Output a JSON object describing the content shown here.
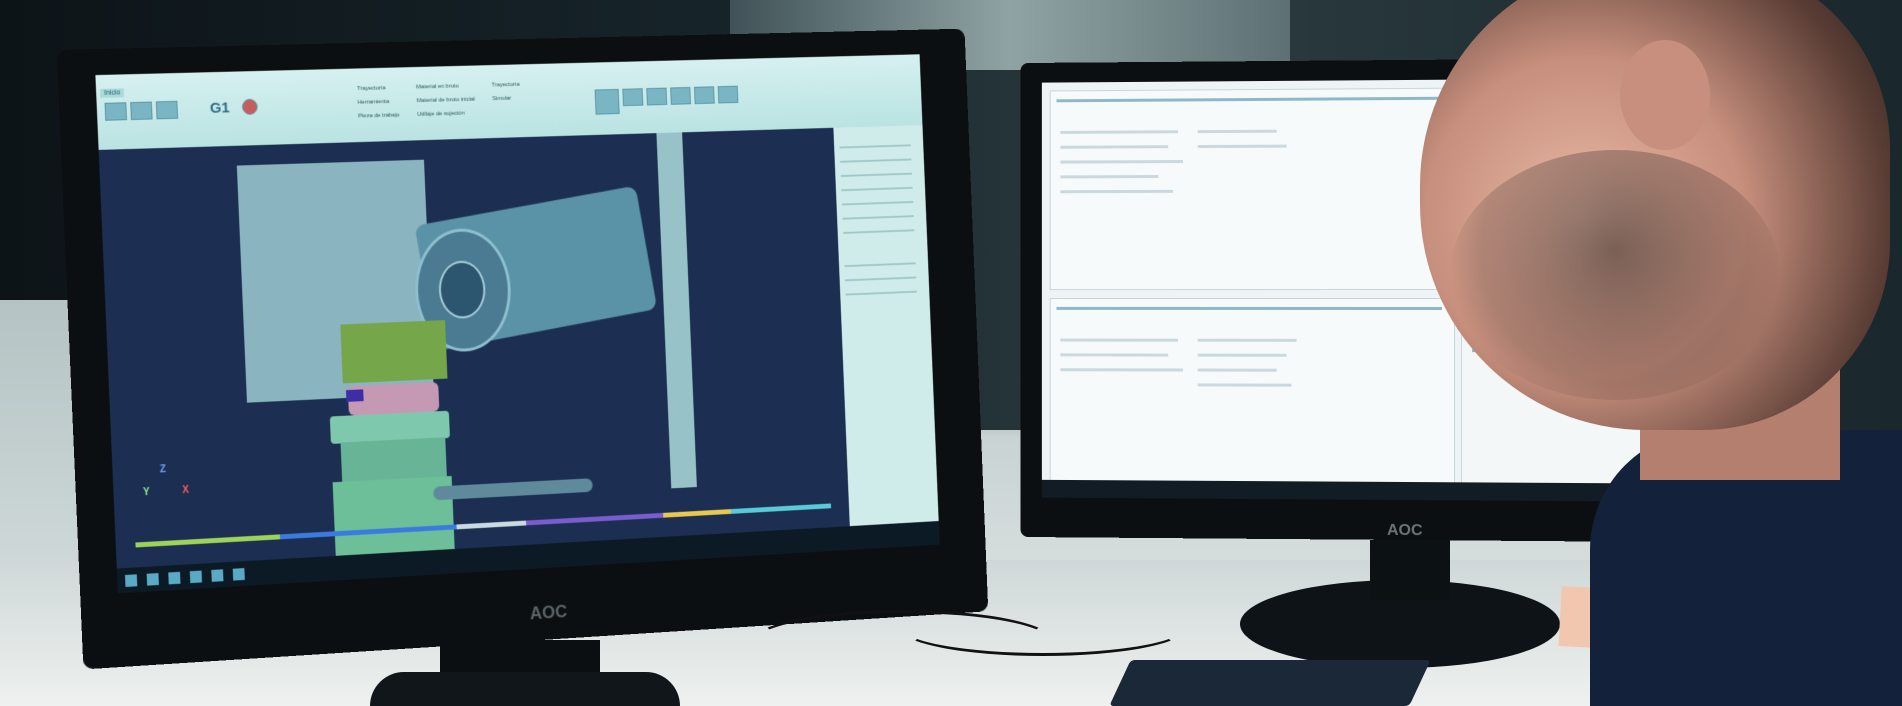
{
  "monitors": {
    "left_brand": "AOC",
    "right_brand": "AOC"
  },
  "cad_app": {
    "ribbon_tab_active": "Inicio",
    "ribbon_g1": "G1",
    "axis_labels": {
      "y": "Y",
      "x": "X",
      "z": "Z"
    },
    "checkboxes": [
      "Trayectoria",
      "Herramienta",
      "Pieza de trabajo",
      "Material en bruto",
      "Material de bruto inicial",
      "Utillaje de sujeción",
      "Trayectoria",
      "Simular"
    ]
  },
  "scene": {
    "description_items": [
      "monitor-left",
      "monitor-right",
      "person",
      "keyboard",
      "desk"
    ]
  },
  "colors": {
    "viewport": "#1c2f52",
    "ribbon": "#c7e9e8",
    "desk": "#e3e8e6",
    "shirt": "#14213a"
  }
}
